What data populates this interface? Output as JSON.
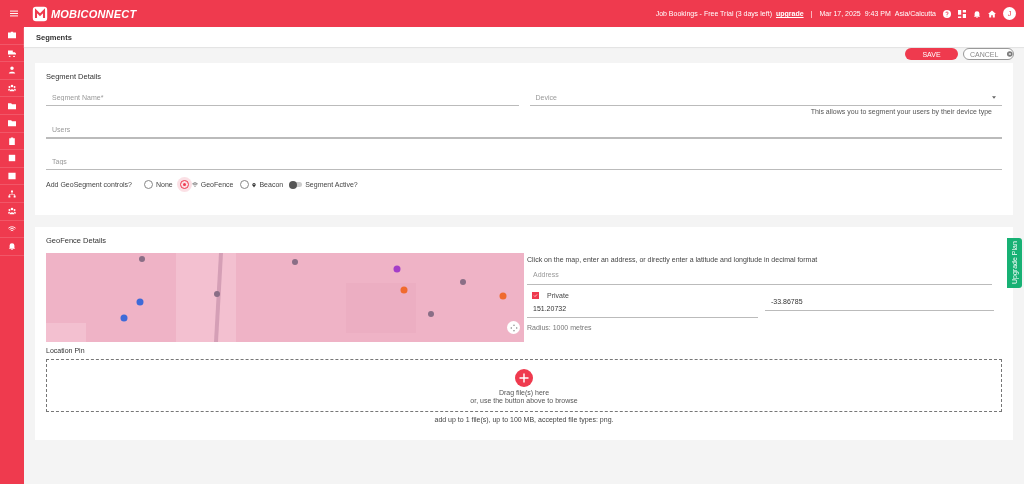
{
  "header": {
    "logo": "MOBICONNECT",
    "trial_text": "Job Bookings - Free Trial (3 days left)",
    "upgrade_link": "upgrade",
    "separator": "|",
    "date": "Mar 17, 2025",
    "time": "9:43 PM",
    "timezone": "Asia/Calcutta",
    "avatar": "J"
  },
  "page_title": "Segments",
  "actions": {
    "save": "SAVE",
    "cancel": "CANCEL"
  },
  "segment_details": {
    "title": "Segment Details",
    "segment_name": {
      "placeholder": "Segment Name*"
    },
    "device": {
      "placeholder": "Device",
      "hint": "This allows you to segment your users by their device type"
    },
    "users": {
      "placeholder": "Users"
    },
    "tags": {
      "placeholder": "Tags"
    },
    "geo_label": "Add GeoSegment controls?",
    "geo_options": [
      {
        "label": "None",
        "kind": "plain",
        "selected": false
      },
      {
        "label": "GeoFence",
        "kind": "wifi",
        "selected": true
      },
      {
        "label": "Beacon",
        "kind": "pin",
        "selected": false
      }
    ],
    "active_toggle": {
      "label": "Segment Active?",
      "on": false
    }
  },
  "geofence_details": {
    "title": "GeoFence Details",
    "instruction": "Click on the map, enter an address, or directly enter a latitude and longitude in decimal format",
    "address": {
      "placeholder": "Address"
    },
    "private": {
      "label": "Private",
      "checked": true
    },
    "latitude": {
      "value": "-33.86785"
    },
    "longitude": {
      "value": "151.20732"
    },
    "radius": "Radius: 1000 metres",
    "location_pin": "Location Pin",
    "dropzone": {
      "line1": "Drag file(s) here",
      "line2": "or, use the button above to browse"
    },
    "note": "add up to 1 file(s), up to 100 MB, accepted file types: png."
  },
  "upgrade_tab": "Upgrade Plan"
}
